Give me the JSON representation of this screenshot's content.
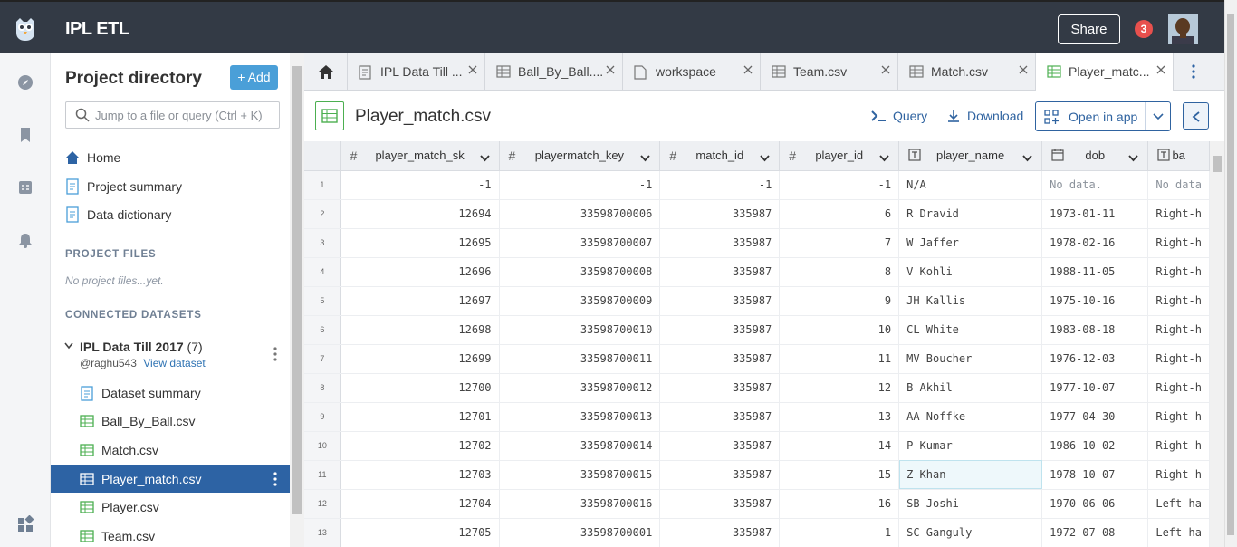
{
  "app": {
    "title": "IPL ETL",
    "share_label": "Share",
    "notification_count": "3"
  },
  "sidebar": {
    "heading": "Project directory",
    "add_label": "+ Add",
    "search_placeholder": "Jump to a file or query (Ctrl + K)",
    "nav": [
      {
        "label": "Home",
        "icon": "home-icon"
      },
      {
        "label": "Project summary",
        "icon": "document-icon"
      },
      {
        "label": "Data dictionary",
        "icon": "document-icon"
      }
    ],
    "project_files_label": "PROJECT FILES",
    "project_files_empty": "No project files...yet.",
    "connected_label": "CONNECTED DATASETS",
    "dataset": {
      "name": "IPL Data Till 2017",
      "count": "(7)",
      "owner": "@raghu543",
      "view_link": "View dataset",
      "files": [
        {
          "label": "Dataset summary",
          "icon": "document-icon"
        },
        {
          "label": "Ball_By_Ball.csv",
          "icon": "table-icon"
        },
        {
          "label": "Match.csv",
          "icon": "table-icon"
        },
        {
          "label": "Player_match.csv",
          "icon": "table-icon",
          "active": true
        },
        {
          "label": "Player.csv",
          "icon": "table-icon"
        },
        {
          "label": "Team.csv",
          "icon": "table-icon"
        }
      ]
    }
  },
  "tabs": [
    {
      "label": "IPL Data Till ...",
      "icon": "document-icon"
    },
    {
      "label": "Ball_By_Ball....",
      "icon": "table-icon"
    },
    {
      "label": "workspace",
      "icon": "file-icon"
    },
    {
      "label": "Team.csv",
      "icon": "table-icon"
    },
    {
      "label": "Match.csv",
      "icon": "table-icon"
    },
    {
      "label": "Player_matc...",
      "icon": "table-icon",
      "active": true
    }
  ],
  "file": {
    "title": "Player_match.csv",
    "query_label": "Query",
    "download_label": "Download",
    "open_label": "Open in app"
  },
  "grid": {
    "columns": [
      {
        "name": "player_match_sk",
        "type": "#"
      },
      {
        "name": "playermatch_key",
        "type": "#"
      },
      {
        "name": "match_id",
        "type": "#"
      },
      {
        "name": "player_id",
        "type": "#"
      },
      {
        "name": "player_name",
        "type": "T"
      },
      {
        "name": "dob",
        "type": "cal"
      },
      {
        "name": "ba",
        "type": "T"
      }
    ],
    "rows": [
      [
        "1",
        "-1",
        "-1",
        "-1",
        "-1",
        "N/A",
        "No data.",
        "No data"
      ],
      [
        "2",
        "12694",
        "33598700006",
        "335987",
        "6",
        "R Dravid",
        "1973-01-11",
        "Right-h"
      ],
      [
        "3",
        "12695",
        "33598700007",
        "335987",
        "7",
        "W Jaffer",
        "1978-02-16",
        "Right-h"
      ],
      [
        "4",
        "12696",
        "33598700008",
        "335987",
        "8",
        "V Kohli",
        "1988-11-05",
        "Right-h"
      ],
      [
        "5",
        "12697",
        "33598700009",
        "335987",
        "9",
        "JH Kallis",
        "1975-10-16",
        "Right-h"
      ],
      [
        "6",
        "12698",
        "33598700010",
        "335987",
        "10",
        "CL White",
        "1983-08-18",
        "Right-h"
      ],
      [
        "7",
        "12699",
        "33598700011",
        "335987",
        "11",
        "MV Boucher",
        "1976-12-03",
        "Right-h"
      ],
      [
        "8",
        "12700",
        "33598700012",
        "335987",
        "12",
        "B Akhil",
        "1977-10-07",
        "Right-h"
      ],
      [
        "9",
        "12701",
        "33598700013",
        "335987",
        "13",
        "AA Noffke",
        "1977-04-30",
        "Right-h"
      ],
      [
        "10",
        "12702",
        "33598700014",
        "335987",
        "14",
        "P Kumar",
        "1986-10-02",
        "Right-h"
      ],
      [
        "11",
        "12703",
        "33598700015",
        "335987",
        "15",
        "Z Khan",
        "1978-10-07",
        "Right-h"
      ],
      [
        "12",
        "12704",
        "33598700016",
        "335987",
        "16",
        "SB Joshi",
        "1970-06-06",
        "Left-ha"
      ],
      [
        "13",
        "12705",
        "33598700001",
        "335987",
        "1",
        "SC Ganguly",
        "1972-07-08",
        "Left-ha"
      ]
    ]
  },
  "colors": {
    "topbar": "#333a45",
    "accent": "#2d63a4",
    "add_button": "#4a9fd8",
    "badge": "#e8504d",
    "csv_green": "#4caf50"
  }
}
